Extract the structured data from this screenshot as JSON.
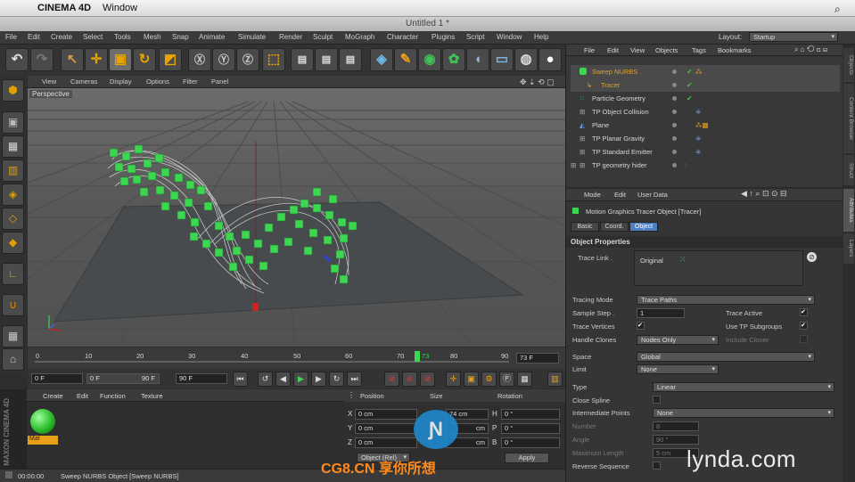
{
  "mac_menu": {
    "apple": "",
    "app": "CINEMA 4D",
    "window": "Window"
  },
  "title": "Untitled 1 *",
  "menu": [
    "File",
    "Edit",
    "Create",
    "Select",
    "Tools",
    "Mesh",
    "Snap",
    "Animate",
    "Simulate",
    "Render",
    "Sculpt",
    "MoGraph",
    "Character",
    "Plugins",
    "Script",
    "Window",
    "Help"
  ],
  "layout": {
    "label": "Layout:",
    "value": "Startup"
  },
  "viewport_menu": [
    "View",
    "Cameras",
    "Display",
    "Options",
    "Filter",
    "Panel"
  ],
  "viewport_label": "Perspective",
  "timeline": {
    "ticks": [
      "0",
      "10",
      "20",
      "30",
      "40",
      "50",
      "60",
      "70",
      "80",
      "90"
    ],
    "current": "73",
    "frame_field": "73 F"
  },
  "playback": {
    "start": "0 F",
    "min": "0 F",
    "max": "90 F",
    "end": "90 F"
  },
  "material_menu": [
    "Create",
    "Edit",
    "Function",
    "Texture"
  ],
  "material": {
    "name": "Mat"
  },
  "coords": {
    "headers": [
      "Position",
      "Size",
      "Rotation"
    ],
    "rows": [
      {
        "axis": "X",
        "pos": "0 cm",
        "size": "74 cm",
        "rot_axis": "H",
        "rot": "0 °"
      },
      {
        "axis": "Y",
        "pos": "0 cm",
        "size": "cm",
        "rot_axis": "P",
        "rot": "0 °"
      },
      {
        "axis": "Z",
        "pos": "0 cm",
        "size": "cm",
        "rot_axis": "B",
        "rot": "0 °"
      }
    ],
    "mode": "Object (Rel)",
    "apply": "Apply"
  },
  "status": {
    "time": "00:00:00",
    "text": "Sweep NURBS Object [Sweep NURBS]"
  },
  "objmgr_menu": [
    "File",
    "Edit",
    "View",
    "Objects",
    "Tags",
    "Bookmarks"
  ],
  "objects": [
    {
      "name": "Sweep NURBS",
      "color": "#e8a01a",
      "indent": 0,
      "checked": true
    },
    {
      "name": "Tracer",
      "color": "#e8a01a",
      "indent": 1,
      "checked": true
    },
    {
      "name": "Particle Geometry",
      "color": "#cfcfcf",
      "indent": 0,
      "checked": true
    },
    {
      "name": "TP Object Collision",
      "color": "#cfcfcf",
      "indent": 0,
      "checked": false
    },
    {
      "name": "Plane",
      "color": "#cfcfcf",
      "indent": 0,
      "checked": false
    },
    {
      "name": "TP Planar Gravity",
      "color": "#cfcfcf",
      "indent": 0,
      "checked": false
    },
    {
      "name": "TP Standard Emitter",
      "color": "#cfcfcf",
      "indent": 0,
      "checked": false
    },
    {
      "name": "TP geometry hider",
      "color": "#cfcfcf",
      "indent": 0,
      "checked": false
    }
  ],
  "attr_menu": [
    "Mode",
    "Edit",
    "User Data"
  ],
  "attr_object_title": "Motion Graphics Tracer Object [Tracer]",
  "attr_tabs": [
    "Basic",
    "Coord.",
    "Object"
  ],
  "attr_section": "Object Properties",
  "trace_link": {
    "label": "Trace Link .",
    "item": "Original"
  },
  "props": {
    "tracing_mode": {
      "label": "Tracing Mode",
      "value": "Trace Paths"
    },
    "sample_step": {
      "label": "Sample Step .",
      "value": "1"
    },
    "trace_active": {
      "label": "Trace Active"
    },
    "trace_vertices": {
      "label": "Trace Vertices"
    },
    "use_tp_subgroups": {
      "label": "Use TP Subgroups"
    },
    "handle_clones": {
      "label": "Handle Clones",
      "value": "Nodes Only"
    },
    "include_cloner": {
      "label": "Include Cloner"
    },
    "space": {
      "label": "Space",
      "value": "Global"
    },
    "limit": {
      "label": "Limit",
      "value": "None"
    },
    "type": {
      "label": "Type",
      "value": "Linear"
    },
    "close_spline": {
      "label": "Close Spline"
    },
    "intermediate_points": {
      "label": "Intermediate Points",
      "value": "None"
    },
    "number": {
      "label": "Number",
      "value": "8"
    },
    "angle": {
      "label": "Angle",
      "value": "90 °"
    },
    "maximum_length": {
      "label": "Maximum Length",
      "value": "5 cm"
    },
    "reverse_sequence": {
      "label": "Reverse Sequence"
    }
  },
  "side_tabs": [
    "Objects",
    "Content Browser",
    "Struct",
    "Attributes",
    "Layers"
  ],
  "watermarks": {
    "lynda": "lynda.com",
    "cg": "CG8.CN 享你所想"
  },
  "colors": {
    "accent": "#e8a01a",
    "particle": "#37c34a",
    "panel": "#353535"
  }
}
